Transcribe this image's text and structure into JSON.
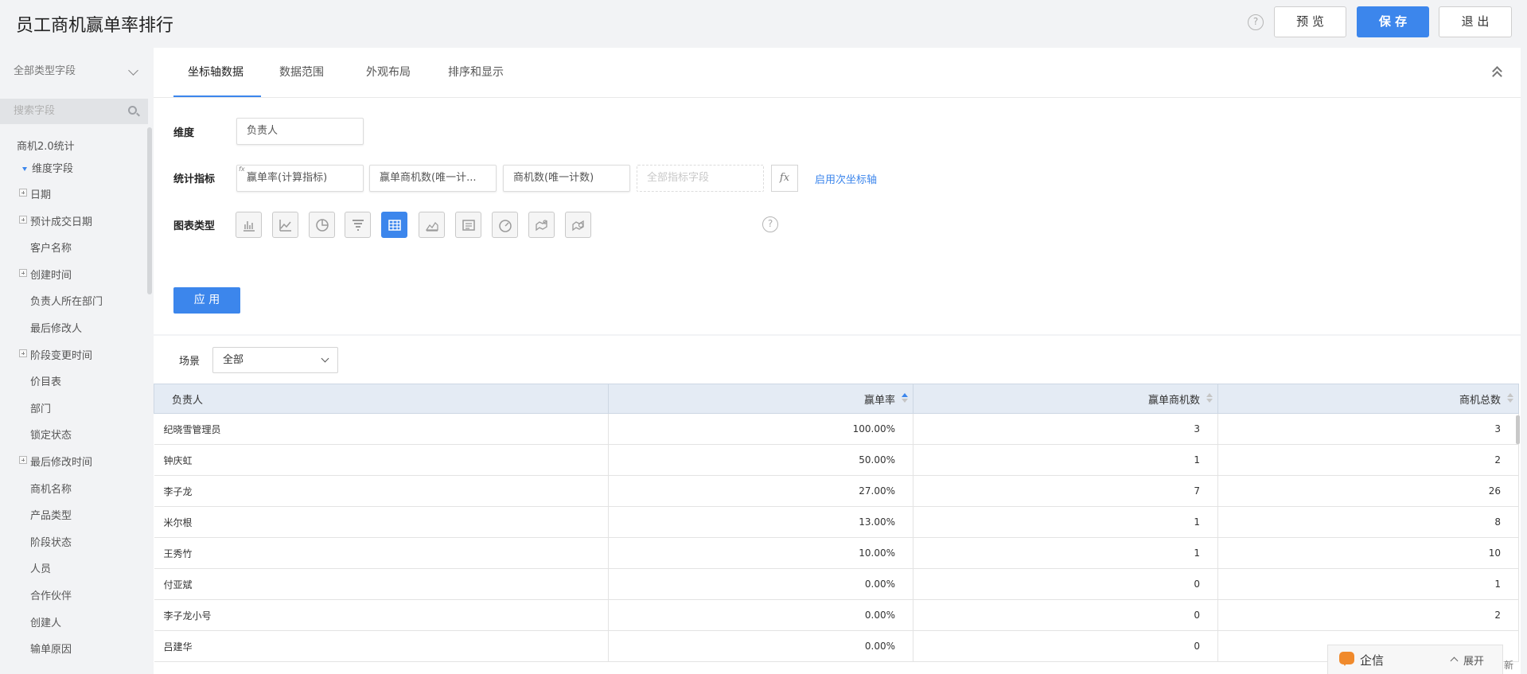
{
  "header": {
    "title": "员工商机赢单率排行",
    "help_glyph": "?",
    "preview_label": "预 览",
    "save_label": "保 存",
    "exit_label": "退 出"
  },
  "sidebar": {
    "field_type_select": "全部类型字段",
    "search_placeholder": "搜索字段",
    "tree_root": "商机2.0统计",
    "tree_group": "维度字段",
    "items": [
      {
        "label": "日期",
        "expandable": true
      },
      {
        "label": "预计成交日期",
        "expandable": true
      },
      {
        "label": "客户名称",
        "expandable": false
      },
      {
        "label": "创建时间",
        "expandable": true
      },
      {
        "label": "负责人所在部门",
        "expandable": false
      },
      {
        "label": "最后修改人",
        "expandable": false
      },
      {
        "label": "阶段变更时间",
        "expandable": true
      },
      {
        "label": "价目表",
        "expandable": false
      },
      {
        "label": "部门",
        "expandable": false
      },
      {
        "label": "锁定状态",
        "expandable": false
      },
      {
        "label": "最后修改时间",
        "expandable": true
      },
      {
        "label": "商机名称",
        "expandable": false
      },
      {
        "label": "产品类型",
        "expandable": false
      },
      {
        "label": "阶段状态",
        "expandable": false
      },
      {
        "label": "人员",
        "expandable": false
      },
      {
        "label": "合作伙伴",
        "expandable": false
      },
      {
        "label": "创建人",
        "expandable": false
      },
      {
        "label": "输单原因",
        "expandable": false
      }
    ]
  },
  "config": {
    "tabs": [
      "坐标轴数据",
      "数据范围",
      "外观布局",
      "排序和显示"
    ],
    "active_tab": 0,
    "dimension_label": "维度",
    "dimension_value": "负责人",
    "metric_label": "统计指标",
    "metrics": [
      "赢单率(计算指标)",
      "赢单商机数(唯一计...",
      "商机数(唯一计数)"
    ],
    "metric_fx_badge": "fx",
    "metric_placeholder": "全部指标字段",
    "fx_button": "fx",
    "secondary_axis_link": "启用次坐标轴",
    "chart_type_label": "图表类型",
    "chart_types": [
      "bar-chart-icon",
      "line-chart-icon",
      "pie-chart-icon",
      "funnel-chart-icon",
      "table-chart-icon",
      "area-chart-icon",
      "text-card-icon",
      "gauge-chart-icon",
      "map-chart-icon",
      "map-bubble-icon"
    ],
    "active_chart_type": "table-chart-icon",
    "apply_label": "应 用"
  },
  "result": {
    "scene_label": "场景",
    "scene_value": "全部",
    "columns": [
      "负责人",
      "赢单率",
      "赢单商机数",
      "商机总数"
    ],
    "rows": [
      [
        "纪晓雪管理员",
        "100.00%",
        "3",
        "3"
      ],
      [
        "钟庆虹",
        "50.00%",
        "1",
        "2"
      ],
      [
        "李子龙",
        "27.00%",
        "7",
        "26"
      ],
      [
        "米尔根",
        "13.00%",
        "1",
        "8"
      ],
      [
        "王秀竹",
        "10.00%",
        "1",
        "10"
      ],
      [
        "付亚斌",
        "0.00%",
        "0",
        "1"
      ],
      [
        "李子龙小号",
        "0.00%",
        "0",
        "2"
      ],
      [
        "吕建华",
        "0.00%",
        "0",
        ""
      ]
    ]
  },
  "chat_widget": {
    "label": "企信",
    "expand_label": "展开"
  },
  "corner_text": "新",
  "colors": {
    "accent": "#3c86ec",
    "header_bg": "#e4ebf4",
    "chat_icon": "#f08a2c"
  }
}
